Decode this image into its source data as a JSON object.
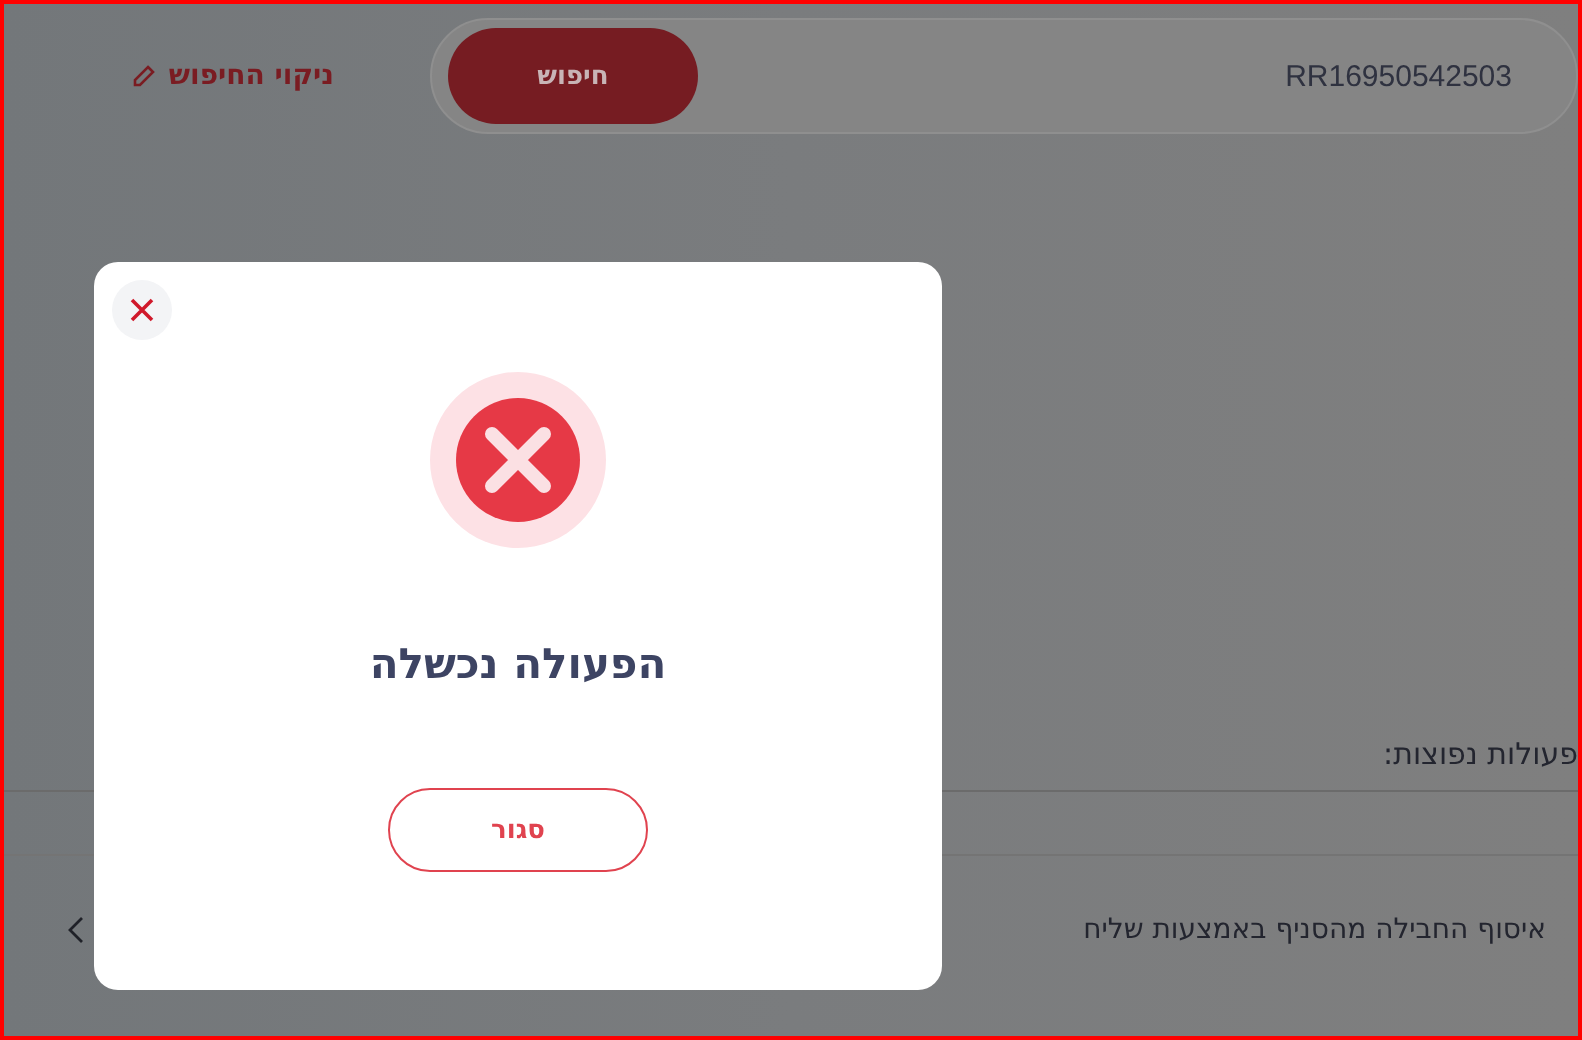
{
  "search": {
    "value": "RR16950542503",
    "button": "חיפוש",
    "clear": "ניקוי החיפוש"
  },
  "common_actions": {
    "title": "פעולות נפוצות:",
    "items": [
      {
        "label": "איסוף החבילה מהסניף באמצעות שליח"
      }
    ]
  },
  "dialog": {
    "kind": "error",
    "title": "הפעולה נכשלה",
    "button": "סגור"
  }
}
